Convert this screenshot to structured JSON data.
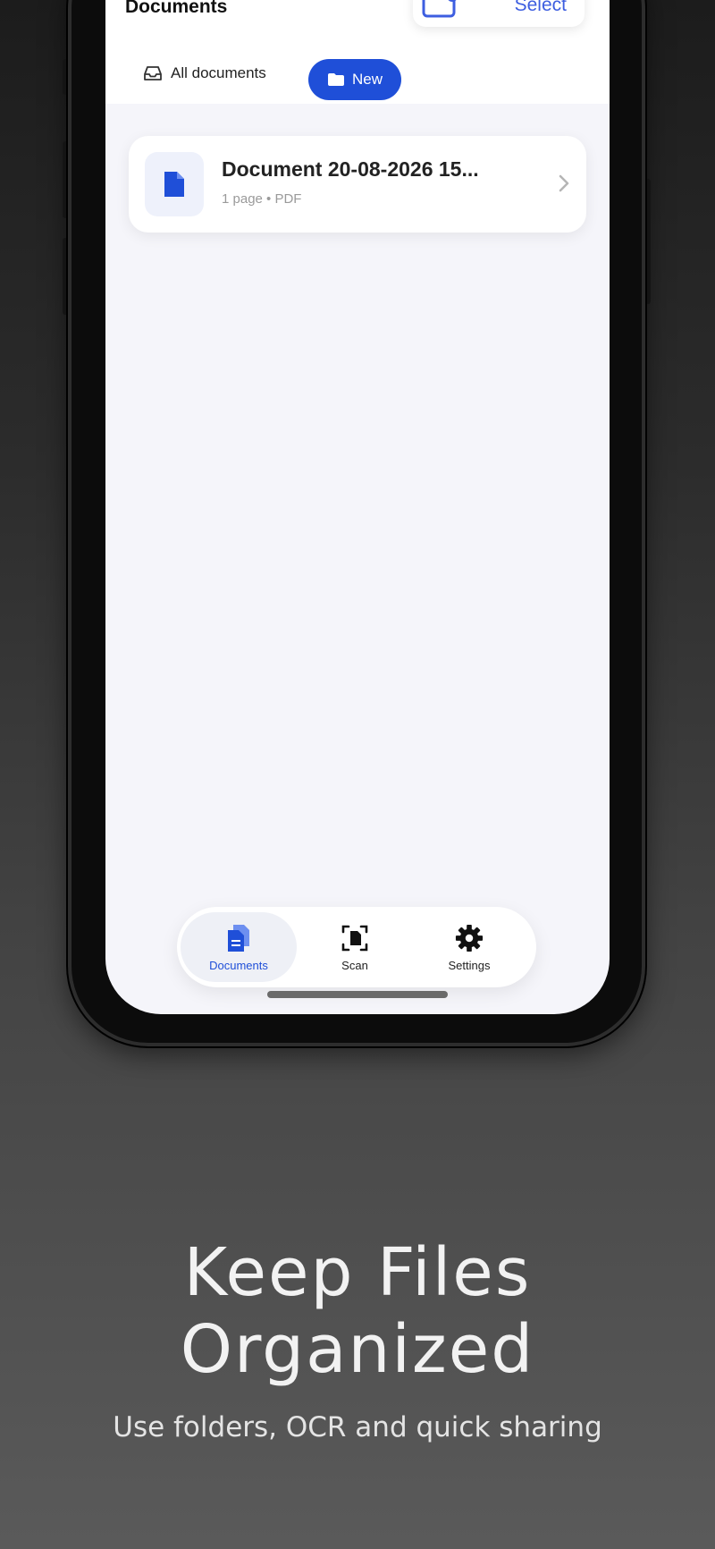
{
  "app": {
    "header": {
      "title": "Documents",
      "select_label": "Select"
    },
    "filters": {
      "all_label": "All documents",
      "new_label": "New"
    },
    "documents": [
      {
        "name": "Document 20-08-2026 15...",
        "meta": "1 page • PDF"
      }
    ],
    "tabs": [
      {
        "label": "Documents",
        "icon": "documents-icon",
        "active": true
      },
      {
        "label": "Scan",
        "icon": "scan-icon",
        "active": false
      },
      {
        "label": "Settings",
        "icon": "gear-icon",
        "active": false
      }
    ],
    "accent_color": "#1f4fd8"
  },
  "promo": {
    "title_line1": "Keep Files",
    "title_line2": "Organized",
    "subtitle": "Use folders, OCR and quick sharing"
  }
}
